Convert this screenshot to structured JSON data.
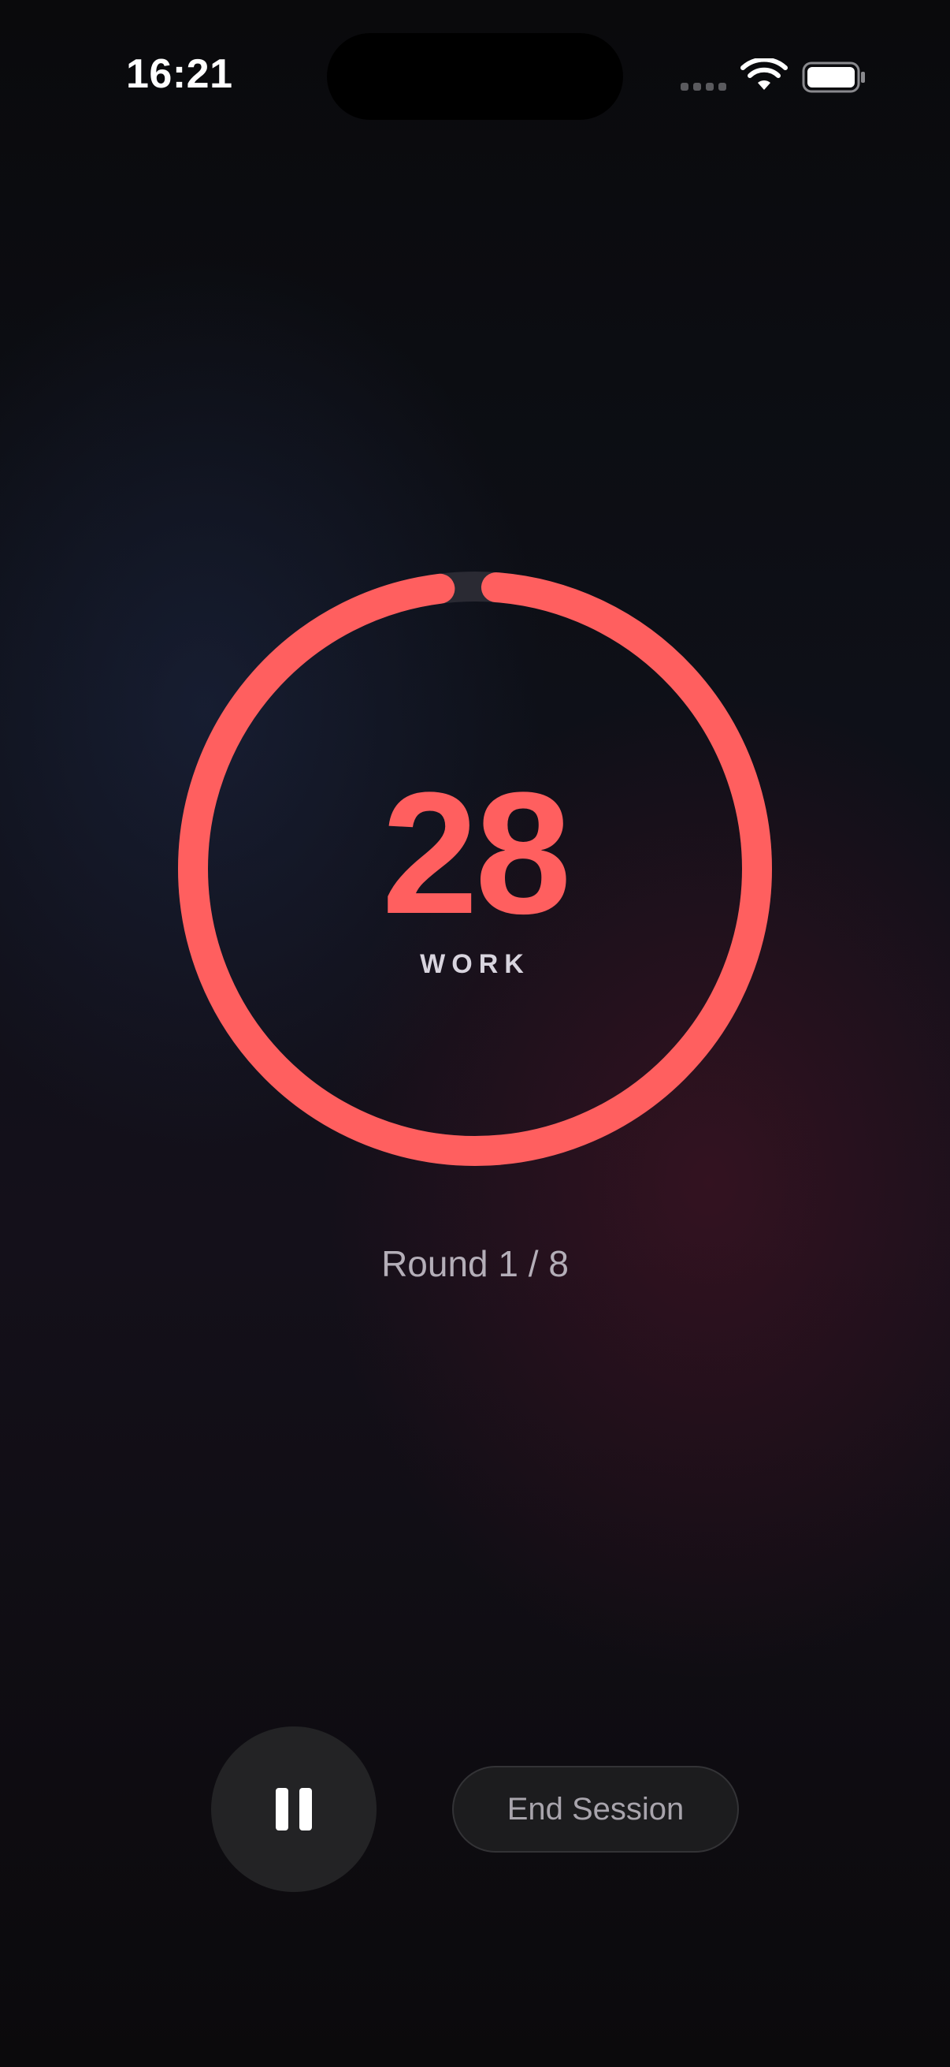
{
  "status_bar": {
    "time": "16:21",
    "signal_icon": "cellular-signal-icon",
    "wifi_icon": "wifi-icon",
    "battery_icon": "battery-icon"
  },
  "timer": {
    "value": "28",
    "phase": "WORK",
    "progress_fraction": 0.98,
    "accent_color": "#ff5f5f",
    "track_color": "#2a2a33"
  },
  "round": {
    "label": "Round 1 / 8"
  },
  "controls": {
    "pause_icon": "pause-icon",
    "end_label": "End Session"
  }
}
